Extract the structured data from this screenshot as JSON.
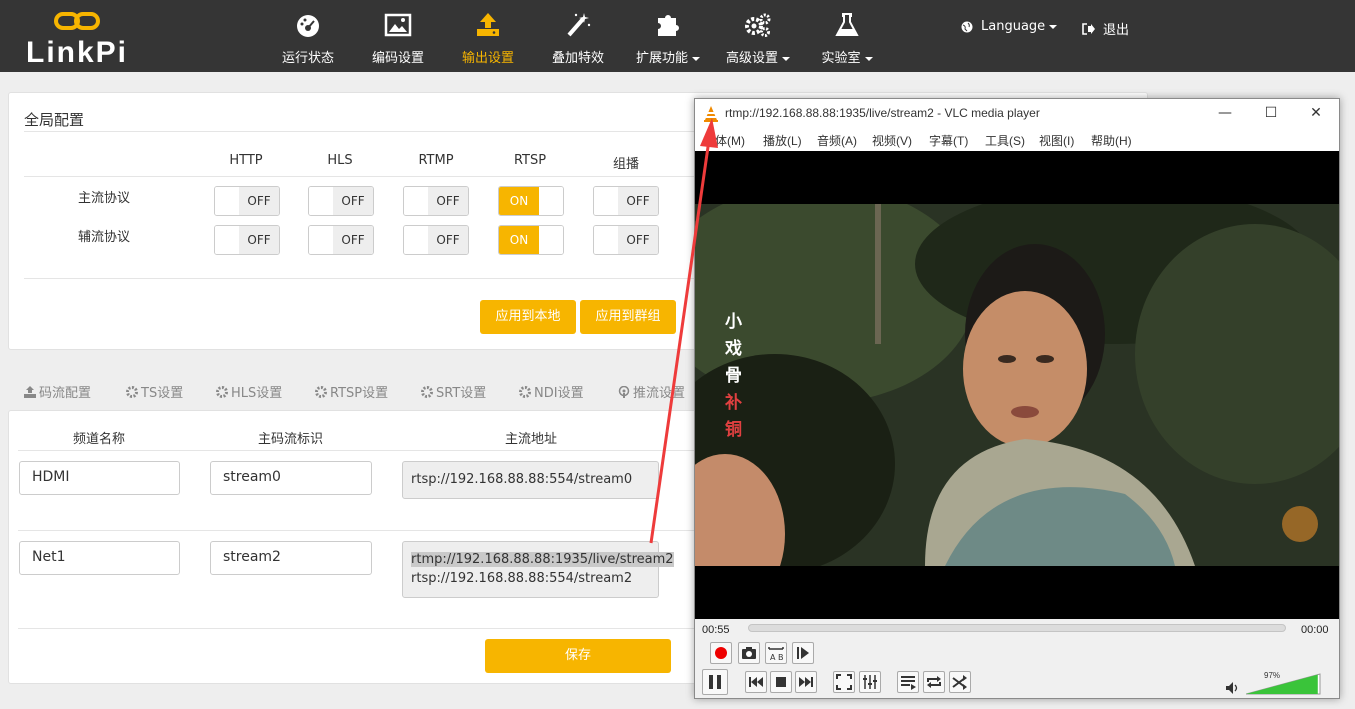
{
  "brand": "LinkPi",
  "nav": [
    {
      "label": "运行状态",
      "icon": "dashboard-icon"
    },
    {
      "label": "编码设置",
      "icon": "picture-icon"
    },
    {
      "label": "输出设置",
      "icon": "upload-icon"
    },
    {
      "label": "叠加特效",
      "icon": "magic-wand-icon"
    },
    {
      "label": "扩展功能",
      "icon": "puzzle-icon"
    },
    {
      "label": "高级设置",
      "icon": "gears-icon"
    },
    {
      "label": "实验室",
      "icon": "flask-icon"
    }
  ],
  "language_label": "Language",
  "logout_label": "退出",
  "global": {
    "title": "全局配置",
    "columns": [
      "HTTP",
      "HLS",
      "RTMP",
      "RTSP",
      "组播"
    ],
    "rows": [
      {
        "label": "主流协议",
        "states": [
          "OFF",
          "OFF",
          "OFF",
          "ON",
          "OFF"
        ]
      },
      {
        "label": "辅流协议",
        "states": [
          "OFF",
          "OFF",
          "OFF",
          "ON",
          "OFF"
        ]
      }
    ],
    "apply_local": "应用到本地",
    "apply_group": "应用到群组"
  },
  "tabs": [
    "码流配置",
    "TS设置",
    "HLS设置",
    "RTSP设置",
    "SRT设置",
    "NDI设置",
    "推流设置"
  ],
  "stream_table": {
    "headers": [
      "频道名称",
      "主码流标识",
      "主流地址"
    ],
    "rows": [
      {
        "name": "HDMI",
        "id": "stream0",
        "url1": "rtsp://192.168.88.88:554/stream0",
        "url2": ""
      },
      {
        "name": "Net1",
        "id": "stream2",
        "url1": "rtmp://192.168.88.88:1935/live/stream2",
        "url2": "rtsp://192.168.88.88:554/stream2"
      }
    ],
    "save": "保存"
  },
  "vlc": {
    "title": "rtmp://192.168.88.88:1935/live/stream2 - VLC media player",
    "menu": [
      "媒体(M)",
      "播放(L)",
      "音频(A)",
      "视频(V)",
      "字幕(T)",
      "工具(S)",
      "视图(I)",
      "帮助(H)"
    ],
    "subtitle_chars": [
      "小",
      "戏",
      "骨",
      "补",
      "铜"
    ],
    "time_elapsed": "00:55",
    "time_total": "00:00",
    "volume": "97%",
    "volume_level": 0.97,
    "accent": "#f7b500"
  }
}
